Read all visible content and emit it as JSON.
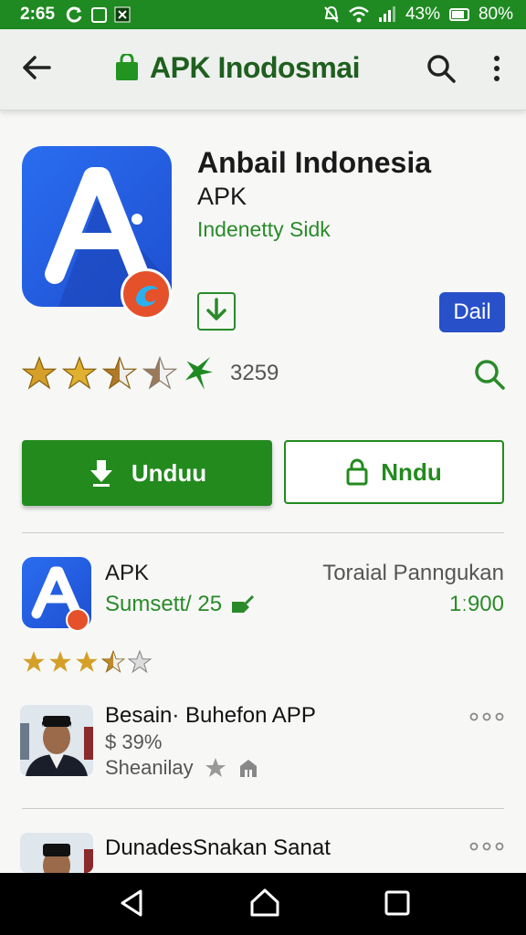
{
  "status": {
    "time": "2:65",
    "battery_text": "43%",
    "battery_text_2": "80%"
  },
  "appbar": {
    "title": "APK Inodosmai"
  },
  "app": {
    "name": "Anbail Indonesia",
    "subtitle": "APK",
    "developer": "Indenetty Sidk",
    "dail_label": "Dail",
    "rating_count": "3259"
  },
  "actions": {
    "primary_label": "Unduu",
    "secondary_label": "Nndu"
  },
  "list_item": {
    "title": "APK",
    "sub": "Sumsett/ 25",
    "right_label": "Toraial Panngukan",
    "right_value": "1ː900"
  },
  "people": [
    {
      "title": "Besain· Buhefon APP",
      "line1": "$ 39%",
      "line2": "Sheanilay"
    },
    {
      "title": "DunadesSnakan Sanat"
    }
  ],
  "colors": {
    "status_green": "#1f8a22",
    "primary_green": "#238a1e",
    "dail_blue": "#2850c8",
    "app_blue": "#2a6df0",
    "badge_orange": "#e5512a"
  }
}
